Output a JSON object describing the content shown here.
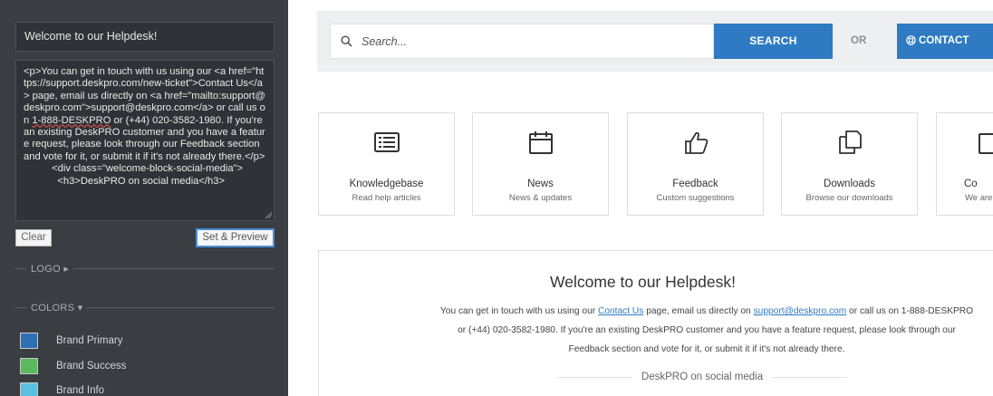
{
  "editor": {
    "title_value": "Welcome to our Helpdesk!",
    "code_before": "<p>You can get in touch with us using our <a href=\"https://support.deskpro.com/new-ticket\">Contact Us</a> page, email us directly on <a href=\"mailto:support@deskpro.com\">support@deskpro.com</a> or call us on ",
    "code_phone": "1-888-DESKPRO",
    "code_after": " or (+44) 020-3582-1980. If you're an existing DeskPRO customer and you have a feature request, please look through our Feedback section and vote for it, or submit it if it's not already there.</p>\n          <div class=\"welcome-block-social-media\">\n            <h3>DeskPRO on social media</h3>",
    "clear_label": "Clear",
    "preview_label": "Set & Preview",
    "logo_label": "LOGO",
    "colors_label": "COLORS",
    "colors": [
      {
        "label": "Brand Primary",
        "color": "#2f6fb3"
      },
      {
        "label": "Brand Success",
        "color": "#5cb85c"
      },
      {
        "label": "Brand Info",
        "color": "#5bc0de"
      }
    ]
  },
  "header": {
    "search_placeholder": "Search...",
    "search_button": "SEARCH",
    "or_label": "OR",
    "contact_button": "CONTACT"
  },
  "cards": [
    {
      "title": "Knowledgebase",
      "subtitle": "Read help articles",
      "icon": "list-icon"
    },
    {
      "title": "News",
      "subtitle": "News & updates",
      "icon": "calendar-icon"
    },
    {
      "title": "Feedback",
      "subtitle": "Custom suggestions",
      "icon": "thumbs-up-icon"
    },
    {
      "title": "Downloads",
      "subtitle": "Browse our downloads",
      "icon": "documents-icon"
    },
    {
      "title": "Co",
      "subtitle": "We are",
      "icon": "contact-icon"
    }
  ],
  "welcome": {
    "title": "Welcome to our Helpdesk!",
    "line1_a": "You can get in touch with us using our ",
    "line1_link1": "Contact Us",
    "line1_b": " page, email us directly on ",
    "line1_link2": "support@deskpro.com",
    "line1_c": " or call us on 1-888-DESKPRO",
    "line2": "or (+44) 020-3582-1980. If you're an existing DeskPRO customer and you have a feature request, please look through our",
    "line3": "Feedback section and vote for it, or submit it if it's not already there.",
    "social_heading": "DeskPRO on social media"
  },
  "accent_color": "#2f7bc3"
}
